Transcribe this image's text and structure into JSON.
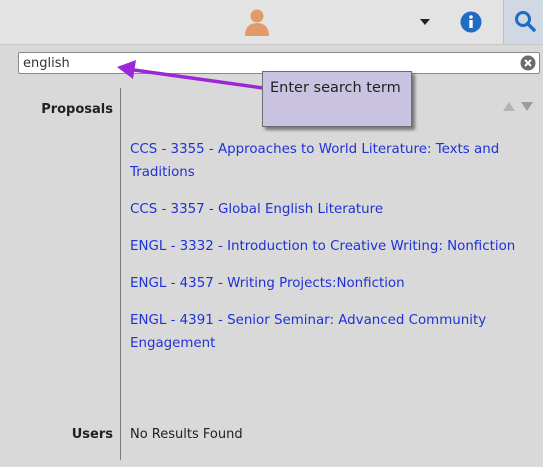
{
  "search": {
    "value": "english",
    "placeholder": ""
  },
  "callout": {
    "text": "Enter search term"
  },
  "results": {
    "proposals_label": "Proposals",
    "users_label": "Users",
    "users_empty": "No Results Found",
    "proposals": [
      {
        "label": "CCS - 3355 - Approaches to World Literature: Texts and Traditions"
      },
      {
        "label": "CCS - 3357 - Global English Literature"
      },
      {
        "label": "ENGL - 3332 - Introduction to Creative Writing: Nonfiction"
      },
      {
        "label": "ENGL - 4357 - Writing Projects:Nonfiction"
      },
      {
        "label": "ENGL - 4391 - Senior Seminar: Advanced Community Engagement"
      }
    ]
  },
  "icons": {
    "user": "user-icon",
    "dropdown": "caret-down-icon",
    "info": "info-icon",
    "search": "search-icon",
    "clear": "clear-x-icon",
    "sort": "sort-up-down-icon"
  },
  "colors": {
    "link": "#1f32d6",
    "callout_bg": "#c9c2e0",
    "arrow": "#9b27d8",
    "panel_bg": "#d9d9d9",
    "info_blue": "#1f6cc4"
  }
}
